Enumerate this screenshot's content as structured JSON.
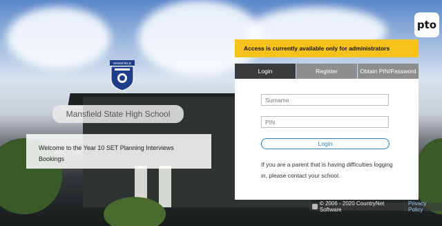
{
  "crest": {
    "banner": "MANSFIELD"
  },
  "school_name": "Mansfield State High School",
  "welcome_text": "Welcome to the Year 10 SET Planning Interviews Bookings",
  "alert": "Access is currently available only for administrators",
  "tabs": [
    {
      "label": "Login",
      "active": true
    },
    {
      "label": "Register",
      "active": false
    },
    {
      "label": "Obtain PIN/Password",
      "active": false
    }
  ],
  "form": {
    "surname_placeholder": "Surname",
    "pin_placeholder": "PIN",
    "login_label": "Login",
    "help_text": "If you are a parent that is having difficulties logging in, please contact your school."
  },
  "logo_text": "pto",
  "footer": {
    "copyright": "© 2006 - 2020 CountryNet Software",
    "privacy_link": "Privacy Policy"
  },
  "colors": {
    "alert_bg": "#f6c21b",
    "active_tab": "#3a3b3c",
    "inactive_tab": "#8d8e8f",
    "link": "#2f7fc1"
  }
}
